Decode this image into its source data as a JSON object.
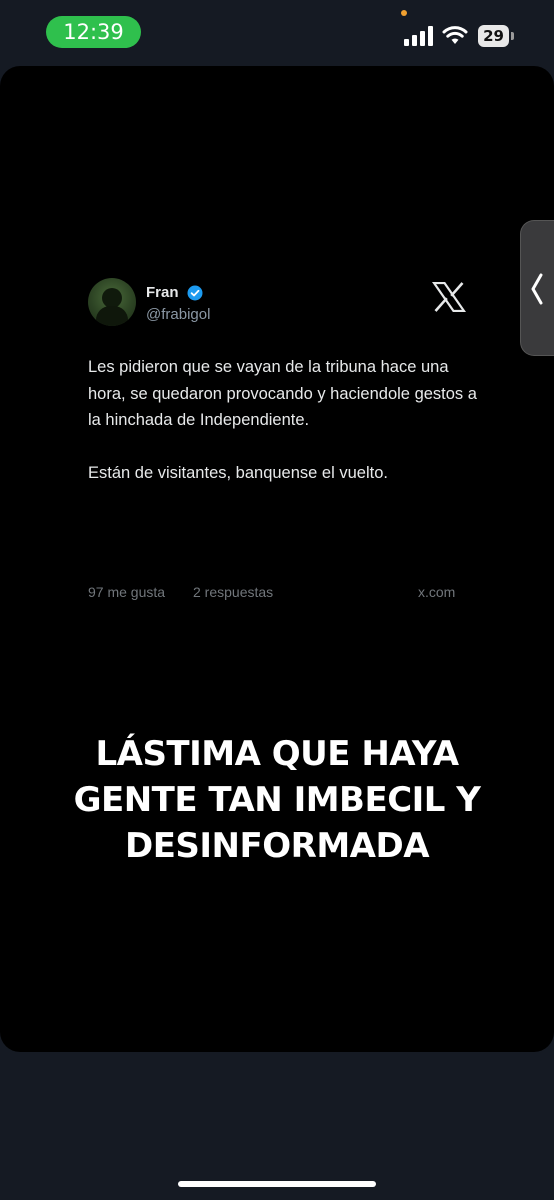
{
  "status_bar": {
    "time": "12:39",
    "battery": "29",
    "colors": {
      "time_pill": "#2fc04d",
      "privacy_dot": "#f0a030"
    }
  },
  "tweet": {
    "author_name": "Fran",
    "author_handle": "@frabigol",
    "verified": true,
    "text_paragraph_1": "Les pidieron que se vayan de la tribuna hace una hora, se quedaron provocando y haciendole gestos a la hinchada de Independiente.",
    "text_paragraph_2": "Están de visitantes, banquense el vuelto.",
    "likes": "97 me gusta",
    "replies": "2 respuestas",
    "site": "x.com",
    "icons": [
      "verified-badge-icon",
      "x-logo-icon"
    ]
  },
  "caption": {
    "line_1": "LÁSTIMA QUE HAYA",
    "line_2": "GENTE TAN IMBECIL Y",
    "line_3": "DESINFORMADA"
  },
  "side_handle_icon": "chevron-left-icon"
}
